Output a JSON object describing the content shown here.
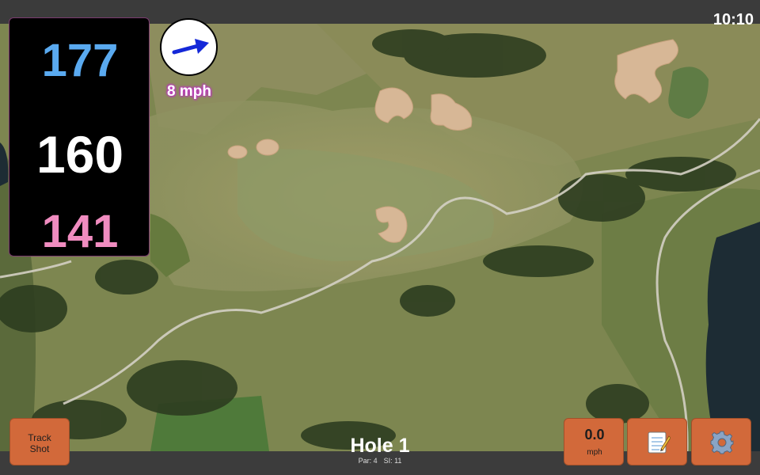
{
  "status_bar": {
    "time": "10:10"
  },
  "distances": {
    "back": "177",
    "middle": "160",
    "front": "141"
  },
  "wind": {
    "speed": "8 mph",
    "icon": "wind-arrow-icon",
    "direction": "east"
  },
  "hole": {
    "title": "Hole 1",
    "par": "Par: 4",
    "si": "SI: 11"
  },
  "buttons": {
    "track_shot_line1": "Track",
    "track_shot_line2": "Shot",
    "speed_value": "0.0",
    "speed_unit": "mph",
    "notes_icon": "notepad-icon",
    "settings_icon": "gear-icon"
  },
  "colors": {
    "back_distance": "#5aaaf0",
    "middle_distance": "#ffffff",
    "front_distance": "#f08cc0",
    "button": "#d2693a",
    "wind_arrow": "#1428d8"
  }
}
